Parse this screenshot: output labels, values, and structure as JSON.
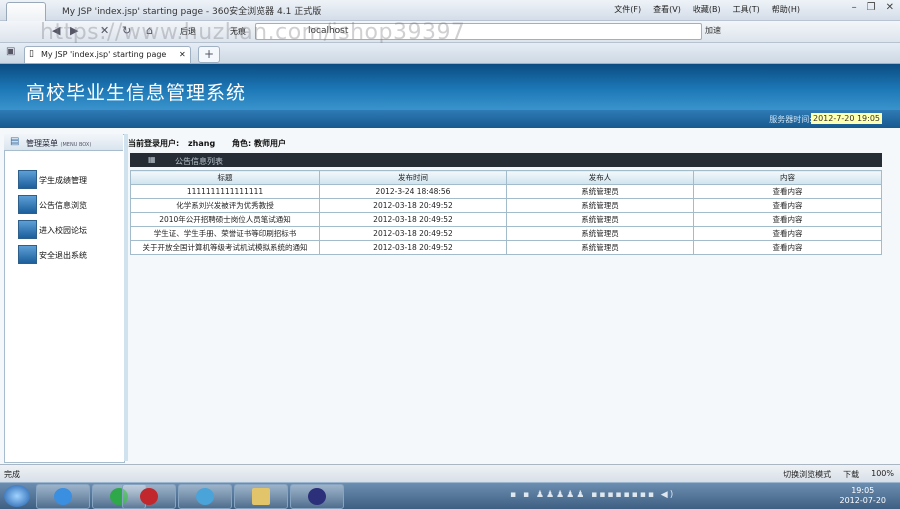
{
  "browser": {
    "window_title": "My JSP 'index.jsp' starting page - 360安全浏览器 4.1 正式版",
    "menus": [
      "文件(F)",
      "查看(V)",
      "收藏(B)",
      "工具(T)",
      "帮助(H)"
    ],
    "back_label": "后退",
    "forward_label": "无痕",
    "address": "localhost",
    "accelerate_label": "加速",
    "tab_title": "My JSP 'index.jsp' starting page",
    "watermark": "https://www.huzhan.com/ishop39397"
  },
  "page": {
    "system_title": "高校毕业生信息管理系统",
    "server_time_label": "服务器时间:",
    "server_time": "2012-7-20 19:05",
    "menu_header": "管理菜单",
    "menu_header_sub": "(MENU BOX)",
    "menu_items": [
      {
        "label": "学生成绩管理"
      },
      {
        "label": "公告信息浏览"
      },
      {
        "label": "进入校园论坛"
      },
      {
        "label": "安全退出系统"
      }
    ],
    "current_user_label": "当前登录用户:",
    "current_user": "zhang",
    "role_label": "角色:",
    "role": "教师用户",
    "list_title": "公告信息列表",
    "columns": [
      "标题",
      "发布时间",
      "发布人",
      "内容"
    ],
    "rows": [
      {
        "title": "1111111111111111",
        "time": "2012-3-24 18:48:56",
        "publisher": "系统管理员",
        "content": "查看内容"
      },
      {
        "title": "化学系刘兴发被评为优秀教授",
        "time": "2012-03-18 20:49:52",
        "publisher": "系统管理员",
        "content": "查看内容"
      },
      {
        "title": "2010年公开招聘硕士岗位人员笔试通知",
        "time": "2012-03-18 20:49:52",
        "publisher": "系统管理员",
        "content": "查看内容"
      },
      {
        "title": "学生证、学生手册、荣誉证书等印刷招标书",
        "time": "2012-03-18 20:49:52",
        "publisher": "系统管理员",
        "content": "查看内容"
      },
      {
        "title": "关于开放全国计算机等级考试机试模拟系统的通知",
        "time": "2012-03-18 20:49:52",
        "publisher": "系统管理员",
        "content": "查看内容"
      }
    ]
  },
  "statusbar": {
    "status": "完成",
    "compat_label": "切换浏览模式",
    "download_label": "下载",
    "zoom": "100%"
  },
  "taskbar": {
    "time": "19:05",
    "date": "2012-07-20"
  }
}
